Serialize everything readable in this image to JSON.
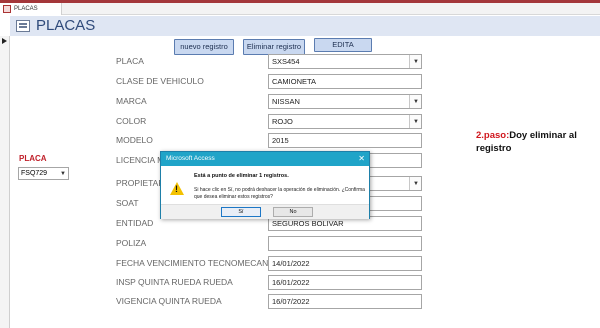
{
  "window": {
    "tab_label": "PLACAS",
    "accent_color": "#a4373a"
  },
  "form": {
    "title": "PLACAS",
    "header_bg": "#dfe6f3",
    "title_color": "#2f4a7a"
  },
  "toolbar": {
    "new_label": "nuevo registro",
    "delete_label": "Eliminar registro",
    "edit_label": "EDITA"
  },
  "fields": [
    {
      "label": "PLACA",
      "value": "SXS454",
      "type": "combo"
    },
    {
      "label": "CLASE DE VEHICULO",
      "value": "CAMIONETA",
      "type": "text"
    },
    {
      "label": "MARCA",
      "value": "NISSAN",
      "type": "combo"
    },
    {
      "label": "COLOR",
      "value": "ROJO",
      "type": "combo"
    },
    {
      "label": "MODELO",
      "value": "2015",
      "type": "text"
    },
    {
      "label": "LICENCIA M",
      "value": "",
      "type": "text"
    },
    {
      "label": "PROPIETARIO",
      "value": "",
      "type": "combo"
    },
    {
      "label": "SOAT",
      "value": "",
      "type": "text"
    },
    {
      "label": "ENTIDAD",
      "value": "SEGUROS BOLIVAR",
      "type": "text"
    },
    {
      "label": "POLIZA",
      "value": "",
      "type": "text"
    },
    {
      "label": "FECHA VENCIMIENTO TECNOMECANICA",
      "value": "14/01/2022",
      "type": "text"
    },
    {
      "label": "INSP QUINTA RUEDA RUEDA",
      "value": "16/01/2022",
      "type": "text"
    },
    {
      "label": "VIGENCIA QUINTA RUEDA",
      "value": "16/07/2022",
      "type": "text"
    }
  ],
  "placa_filter": {
    "label": "PLACA",
    "value": "FSQ729"
  },
  "note": {
    "step": "2.paso:",
    "text": "Doy eliminar al registro"
  },
  "dialog": {
    "title": "Microsoft Access",
    "close": "✕",
    "heading": "Está a punto de eliminar 1 registros.",
    "message": "Si hace clic en Sí, no podrá deshacer la operación de eliminación. ¿Confirma que desea eliminar estos registros?",
    "yes_label": "Sí",
    "no_label": "No",
    "icon": "warning-icon"
  }
}
